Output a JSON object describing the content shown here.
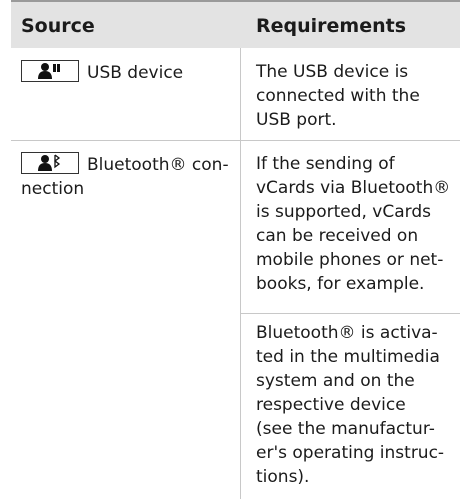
{
  "table": {
    "headers": [
      "Source",
      "Requirements"
    ],
    "rows": [
      {
        "source_icon": "usb-device-icon",
        "source_label": "USB device",
        "requirements": [
          "The USB device is\nconnected with the\nUSB port."
        ]
      },
      {
        "source_icon": "bluetooth-person-icon",
        "source_label": "Bluetooth® con-\nnection",
        "requirements": [
          "If the sending of\nvCards via Bluetooth®\nis supported, vCards\ncan be received on\nmobile phones or net-\nbooks, for example.",
          "Bluetooth® is activa-\nted in the multimedia\nsystem and on the\nrespective device\n(see the manufactur-\ner's operating instruc-\ntions)."
        ]
      }
    ]
  }
}
